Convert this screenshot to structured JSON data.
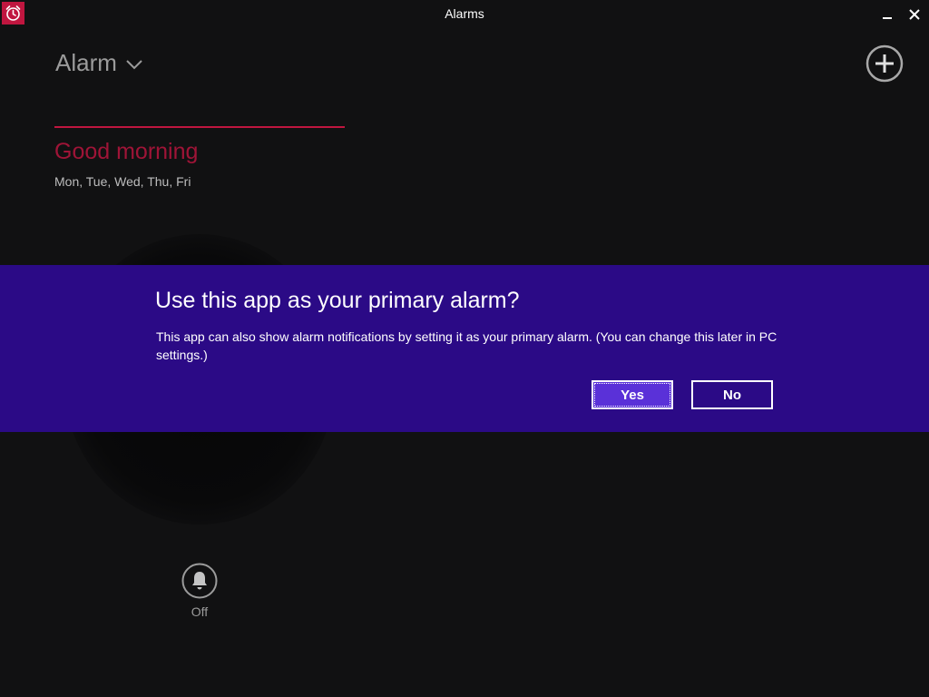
{
  "window": {
    "title": "Alarms"
  },
  "header": {
    "title": "Alarm"
  },
  "alarm": {
    "name": "Good morning",
    "days": "Mon, Tue, Wed, Thu, Fri"
  },
  "bell": {
    "label": "Off"
  },
  "dialog": {
    "title": "Use this app as your primary alarm?",
    "message": "This app can also show alarm notifications by setting it as your primary alarm. (You can change this later in PC settings.)",
    "yes_label": "Yes",
    "no_label": "No"
  },
  "colors": {
    "accent": "#c0163f",
    "dialog_bg": "#2b0a86",
    "yes_button_bg": "#5a31d8",
    "background": "#111112"
  },
  "icons": {
    "app": "alarm-clock-icon",
    "minimize": "minimize-icon",
    "close": "close-icon",
    "dropdown": "chevron-down-icon",
    "add": "plus-circle-icon",
    "bell": "bell-icon"
  }
}
